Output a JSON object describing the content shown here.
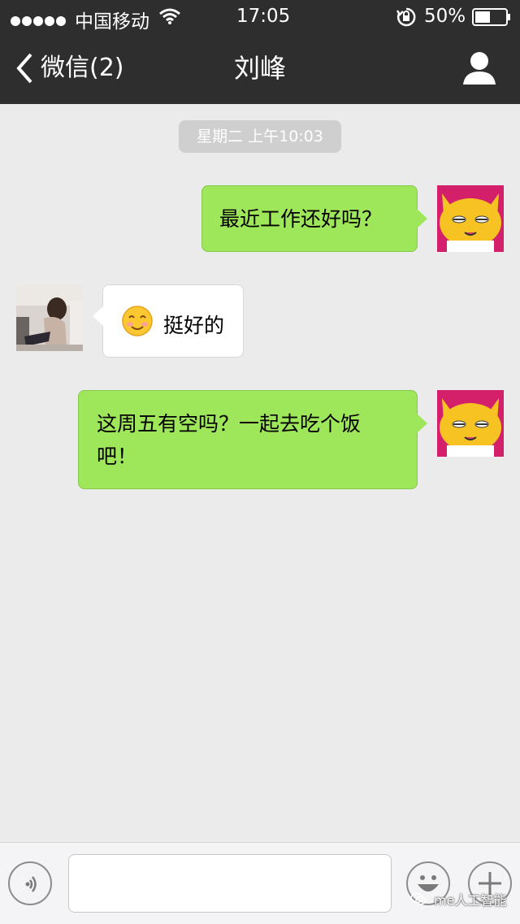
{
  "status_bar": {
    "carrier": "中国移动",
    "time": "17:05",
    "battery_percent": "50%",
    "battery_level": 0.5
  },
  "nav": {
    "back_label": "微信(2)",
    "title": "刘峰"
  },
  "chat": {
    "timestamp": "星期二 上午10:03",
    "messages": [
      {
        "direction": "outgoing",
        "text": "最近工作还好吗？"
      },
      {
        "direction": "incoming",
        "emoji": "smile",
        "text": "挺好的"
      },
      {
        "direction": "outgoing",
        "text_line1": "这周五有空吗？一起去吃个饭",
        "text_line2": "吧！"
      }
    ]
  },
  "input_bar": {
    "input_value": ""
  },
  "watermark": {
    "text": "me人工智能"
  },
  "colors": {
    "bar_background": "#2e2e2e",
    "chat_background": "#ebebeb",
    "outgoing_bubble": "#9ee65a",
    "incoming_bubble": "#ffffff",
    "cat_avatar_bg": "#d41f6a",
    "cat_face": "#f7c322"
  }
}
